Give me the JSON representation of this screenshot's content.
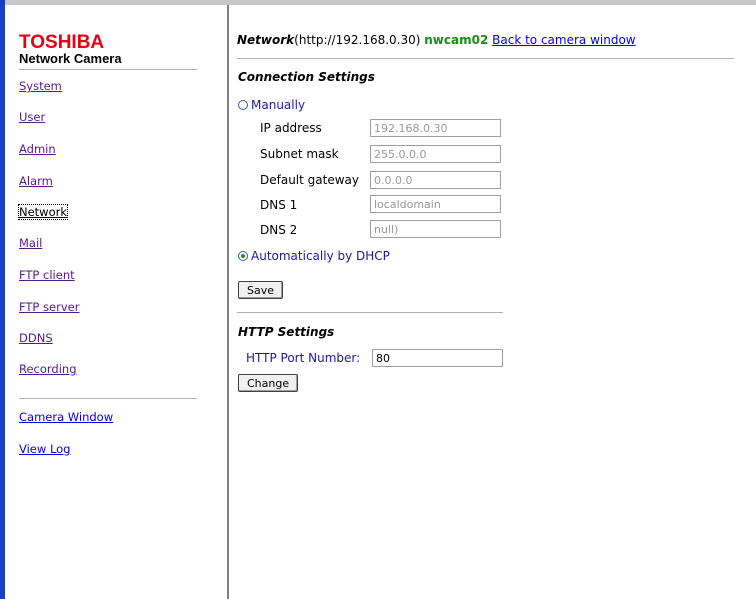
{
  "brand": {
    "name": "TOSHIBA",
    "product": "Network Camera",
    "brand_color": "#e60012"
  },
  "sidebar": {
    "items": [
      {
        "label": "System"
      },
      {
        "label": "User"
      },
      {
        "label": "Admin"
      },
      {
        "label": "Alarm"
      },
      {
        "label": "Network"
      },
      {
        "label": "Mail"
      },
      {
        "label": "FTP client"
      },
      {
        "label": "FTP server"
      },
      {
        "label": "DDNS"
      },
      {
        "label": "Recording"
      }
    ],
    "extra": [
      {
        "label": "Camera Window"
      },
      {
        "label": "View Log"
      }
    ]
  },
  "header": {
    "title": "Network",
    "url": "(http://192.168.0.30)",
    "camera_name": "nwcam02",
    "back_link": "Back to camera window"
  },
  "connection": {
    "section_title": "Connection Settings",
    "manual_label": "Manually",
    "manual_selected": false,
    "fields": [
      {
        "label": "IP address",
        "value": "192.168.0.30"
      },
      {
        "label": "Subnet mask",
        "value": "255.0.0.0"
      },
      {
        "label": "Default gateway",
        "value": "0.0.0.0"
      },
      {
        "label": "DNS 1",
        "value": "localdomain"
      },
      {
        "label": "DNS 2",
        "value": "null)"
      }
    ],
    "dhcp_label": "Automatically by DHCP",
    "dhcp_selected": true,
    "save_label": "Save"
  },
  "http": {
    "section_title": "HTTP Settings",
    "port_label": "HTTP Port Number:",
    "port_value": "80",
    "change_label": "Change"
  }
}
